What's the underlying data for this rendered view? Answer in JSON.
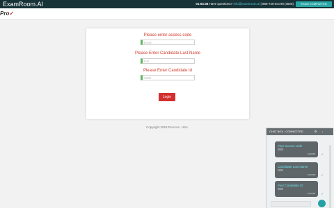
{
  "header": {
    "brand": "ExamRoom.AI",
    "timer": "01:53:36",
    "questions_label": "Have questions?",
    "email": "info@examroom.ai",
    "phone": "| 866-720-EXAM (3926)",
    "exam_button": "EXAM COMPLETED"
  },
  "logo": {
    "text": "Pro",
    "mark": "✓"
  },
  "login": {
    "access_code_label": "Please enter access code",
    "access_code_value": "Exam",
    "last_name_label": "Please Enter Candidate Last Name",
    "last_name_value": "test",
    "candidate_id_label": "Please Enter Candidate Id",
    "candidate_id_value": "0000",
    "button": "Login"
  },
  "footer": {
    "copyright": "Copyright 2018 Prov Inc. USA"
  },
  "chat": {
    "title": "CHAT BOX : CONNECTED",
    "messages": [
      {
        "text": "Your access code",
        "time": "4:40 PM"
      },
      {
        "text": "Candidate Last Name",
        "time": "4:40 PM"
      },
      {
        "text": "Your Candidate ID",
        "time": "4:40 PM"
      }
    ]
  },
  "colors": {
    "accent_red": "#d23a2a",
    "topbar": "#173338",
    "teal": "#2aa7a5"
  }
}
